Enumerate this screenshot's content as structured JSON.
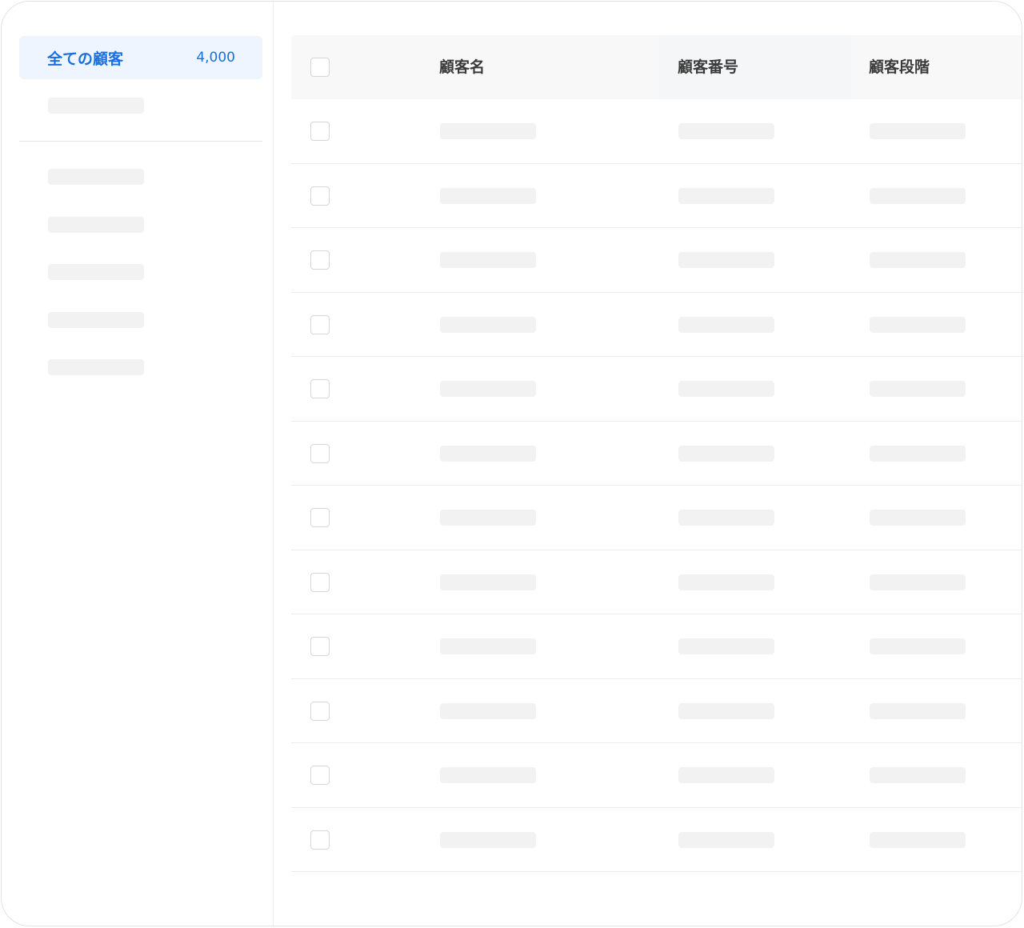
{
  "sidebar": {
    "active_item": {
      "label": "全ての顧客",
      "count": "4,000"
    },
    "colors": {
      "active_bg": "#eef5fe",
      "accent": "#1a6fe0",
      "skeleton": "#f2f2f2"
    }
  },
  "table": {
    "columns": [
      {
        "label": "顧客名"
      },
      {
        "label": "顧客番号"
      },
      {
        "label": "顧客段階"
      }
    ],
    "row_count": 12
  }
}
